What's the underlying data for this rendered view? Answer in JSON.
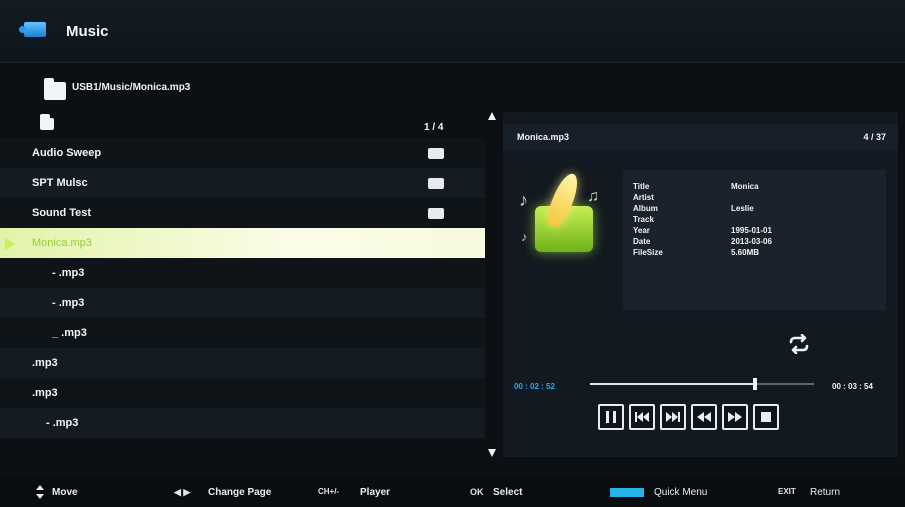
{
  "header": {
    "title": "Music"
  },
  "path": "USB1/Music/Monica.mp3",
  "list": {
    "page_indicator": "1 / 4",
    "rows": [
      {
        "label": "Audio Sweep",
        "type": "folder"
      },
      {
        "label": "SPT Mulsc",
        "type": "folder"
      },
      {
        "label": "Sound Test",
        "type": "folder"
      },
      {
        "label": "Monica.mp3",
        "type": "file",
        "selected": true
      },
      {
        "label": "-   .mp3",
        "type": "file"
      },
      {
        "label": "-   .mp3",
        "type": "file"
      },
      {
        "label": "_ .mp3",
        "type": "file"
      },
      {
        "label": ".mp3",
        "type": "file"
      },
      {
        "label": ".mp3",
        "type": "file"
      },
      {
        "label": "-   .mp3",
        "type": "file"
      }
    ]
  },
  "detail": {
    "filename": "Monica.mp3",
    "count": "4 / 37",
    "meta": [
      {
        "key": "Title",
        "value": "Monica"
      },
      {
        "key": "Artist",
        "value": ""
      },
      {
        "key": "Album",
        "value": "Leslie"
      },
      {
        "key": "Track",
        "value": ""
      },
      {
        "key": "Year",
        "value": "1995-01-01"
      },
      {
        "key": "Date",
        "value": "2013-03-06"
      },
      {
        "key": "FileSize",
        "value": "5.60MB"
      }
    ]
  },
  "player": {
    "elapsed": "00 : 02 : 52",
    "total": "00 : 03 : 54",
    "progress_fraction": 0.735,
    "controls": [
      "pause-icon",
      "previous-icon",
      "next-icon",
      "rewind-icon",
      "fast-forward-icon",
      "stop-icon"
    ]
  },
  "footer": {
    "move": "Move",
    "change_page_glyph": "◀ ▶",
    "change_page": "Change Page",
    "ch_glyph": "CH+/-",
    "player": "Player",
    "ok_glyph": "OK",
    "select": "Select",
    "quick_menu": "Quick Menu",
    "exit_glyph": "EXIT",
    "return": "Return"
  },
  "colors": {
    "accent_blue": "#27b4ea",
    "selection_green": "#c8f05a",
    "background": "#0c1014"
  }
}
